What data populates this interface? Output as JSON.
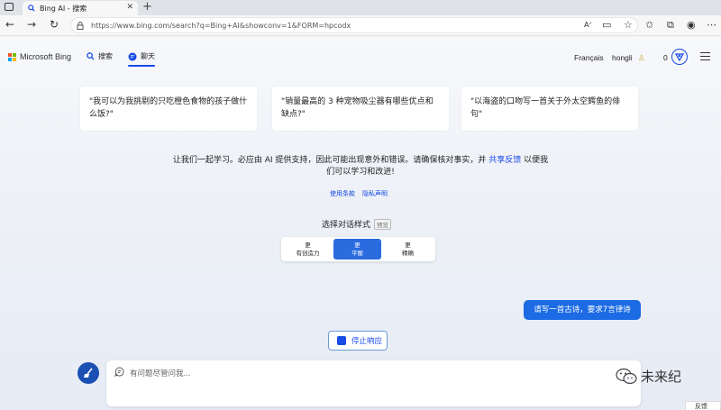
{
  "browser": {
    "tab_title": "Bing AI - 搜索",
    "url": "https://www.bing.com/search?q=Bing+AI&showconv=1&FORM=hpcodx"
  },
  "header": {
    "brand": "Microsoft Bing",
    "nav_search": "搜索",
    "nav_chat": "聊天",
    "language": "Français",
    "user": "hongli",
    "rewards_count": "0"
  },
  "suggestions": [
    "\"我可以为我挑剔的只吃橙色食物的孩子做什么饭?\"",
    "\"销量最高的 3 种宠物吸尘器有哪些优点和缺点?\"",
    "\"以海盗的口吻写一首关于外太空鳄鱼的俳句\""
  ],
  "disclaimer": {
    "text": "让我们一起学习。必应由 AI 提供支持，因此可能出现意外和错误。请确保核对事实，并",
    "link": "共享反馈",
    "text_after": "以便我们可以学习和改进!"
  },
  "legal": {
    "terms": "使用条款",
    "privacy": "隐私声明"
  },
  "conversation_style": {
    "title": "选择对话样式",
    "badge": "预览",
    "options": [
      {
        "line1": "更",
        "line2": "有创造力"
      },
      {
        "line1": "更",
        "line2": "平衡"
      },
      {
        "line1": "更",
        "line2": "精确"
      }
    ],
    "selected": "平衡"
  },
  "chat": {
    "user_message": "请写一首古诗，要求7言律诗",
    "stop_button": "停止响应",
    "input_placeholder": "有问题尽管问我..."
  },
  "watermark": "未来纪",
  "feedback_button": "反馈",
  "colors": {
    "accent": "#174ae4",
    "user_bubble": "#1c6be4",
    "selected_style": "#2a6be0"
  }
}
